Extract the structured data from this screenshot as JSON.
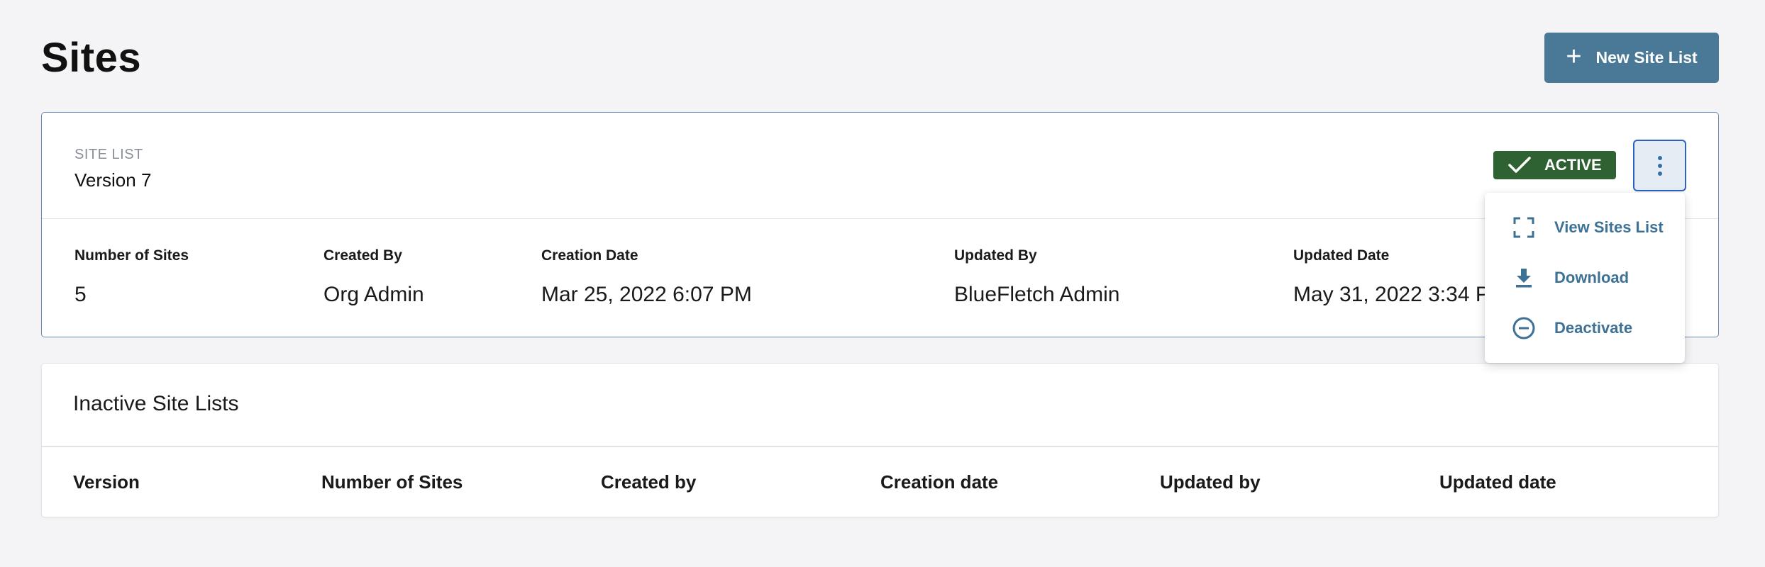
{
  "page": {
    "title": "Sites"
  },
  "header": {
    "new_button_label": "New Site List"
  },
  "active_list": {
    "eyebrow": "SITE LIST",
    "version": "Version 7",
    "status_badge": "ACTIVE",
    "fields": [
      {
        "label": "Number of Sites",
        "value": "5"
      },
      {
        "label": "Created By",
        "value": "Org Admin"
      },
      {
        "label": "Creation Date",
        "value": "Mar 25, 2022 6:07 PM"
      },
      {
        "label": "Updated By",
        "value": "BlueFletch Admin"
      },
      {
        "label": "Updated Date",
        "value": "May 31, 2022 3:34 PM"
      }
    ]
  },
  "actions_menu": {
    "items": [
      {
        "label": "View Sites List",
        "icon": "expand-corners-icon"
      },
      {
        "label": "Download",
        "icon": "download-icon"
      },
      {
        "label": "Deactivate",
        "icon": "minus-circle-icon"
      }
    ]
  },
  "inactive_lists": {
    "title": "Inactive Site Lists",
    "columns": [
      "Version",
      "Number of Sites",
      "Created by",
      "Creation date",
      "Updated by",
      "Updated date"
    ]
  },
  "colors": {
    "background": "#f4f4f6",
    "primary_button": "#4a7897",
    "active_badge": "#2f6233",
    "active_card_border": "#6a8cb4",
    "menu_text": "#3d7196"
  }
}
